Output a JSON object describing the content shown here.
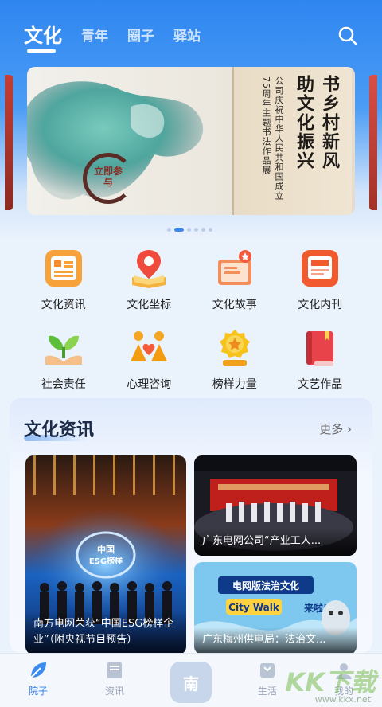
{
  "header": {
    "tabs": [
      {
        "label": "文化",
        "active": true
      },
      {
        "label": "青年",
        "active": false
      },
      {
        "label": "圈子",
        "active": false
      },
      {
        "label": "驿站",
        "active": false
      }
    ],
    "search_icon": "search-icon"
  },
  "banner": {
    "title_col1": "书乡村新风",
    "title_col2": "助文化振兴",
    "sub_col1": "公司庆祝中华人民共和国成立",
    "sub_col2": "75周年主题书法作品展",
    "seal_text": "立即参与",
    "page_count": 6,
    "active_page": 1
  },
  "grid": {
    "items": [
      {
        "label": "文化资讯",
        "icon": "news-icon"
      },
      {
        "label": "文化坐标",
        "icon": "map-pin-book-icon"
      },
      {
        "label": "文化故事",
        "icon": "story-book-icon"
      },
      {
        "label": "文化内刊",
        "icon": "magazine-icon"
      },
      {
        "label": "社会责任",
        "icon": "sprout-hands-icon"
      },
      {
        "label": "心理咨询",
        "icon": "people-heart-icon"
      },
      {
        "label": "榜样力量",
        "icon": "star-medal-icon"
      },
      {
        "label": "文艺作品",
        "icon": "red-book-icon"
      }
    ]
  },
  "news": {
    "title": "文化资讯",
    "more": "更多 ›",
    "cards": [
      {
        "caption": "南方电网荣获“中国ESG榜样企业”（附央视节目预告）"
      },
      {
        "caption": "广东电网公司“产业工人..."
      },
      {
        "caption": "广东梅州供电局：法治文..."
      }
    ],
    "esg_logo_text": "中国 ESG榜样",
    "citywalk_text": "电网版法治文化 City Walk 来啦!"
  },
  "bottom_nav": {
    "items": [
      {
        "label": "院子",
        "icon": "leaf-icon",
        "active": true
      },
      {
        "label": "资讯",
        "icon": "book-icon",
        "active": false
      },
      {
        "label": "南",
        "icon": "center-logo",
        "active": false
      },
      {
        "label": "生活",
        "icon": "cup-icon",
        "active": false
      },
      {
        "label": "我的",
        "icon": "user-icon",
        "active": false
      }
    ]
  },
  "watermark": {
    "text": "KK下载",
    "sub": "www.kkx.net"
  },
  "colors": {
    "primary": "#2f86f0",
    "active_nav": "#2f7ee6",
    "title": "#1c2c48"
  }
}
